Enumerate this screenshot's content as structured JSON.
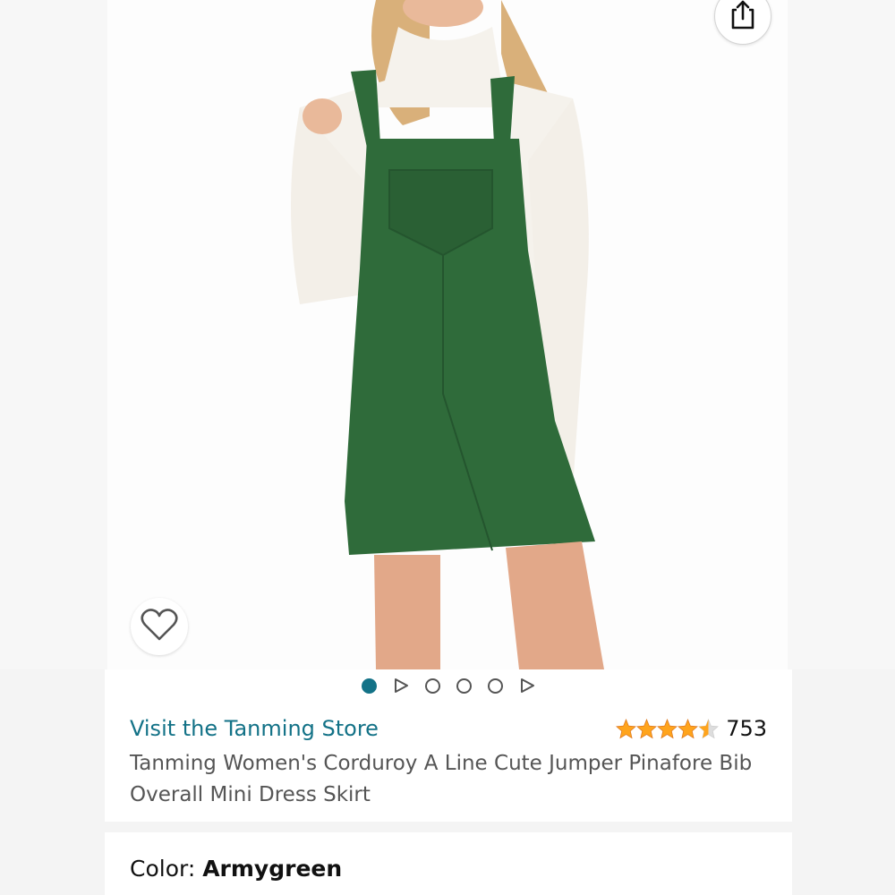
{
  "icons": {
    "share": "share-icon",
    "favorite": "heart-icon",
    "star": "star-icon",
    "carousel_video": "play-triangle-icon"
  },
  "colors": {
    "accent": "#137287",
    "star_fill": "#ffa41c",
    "star_empty": "#dddddd",
    "dress_green": "#2f6b3a"
  },
  "carousel": {
    "indicators": [
      "dot-active",
      "play",
      "dot",
      "dot",
      "dot",
      "play"
    ],
    "active_index": 0
  },
  "product": {
    "store_link": "Visit the Tanming Store",
    "rating_stars": 4.5,
    "rating_count": "753",
    "title": "Tanming Women's Corduroy A Line Cute Jumper Pinafore Bib Overall Mini Dress Skirt"
  },
  "color_selector": {
    "label": "Color: ",
    "value": "Armygreen"
  }
}
